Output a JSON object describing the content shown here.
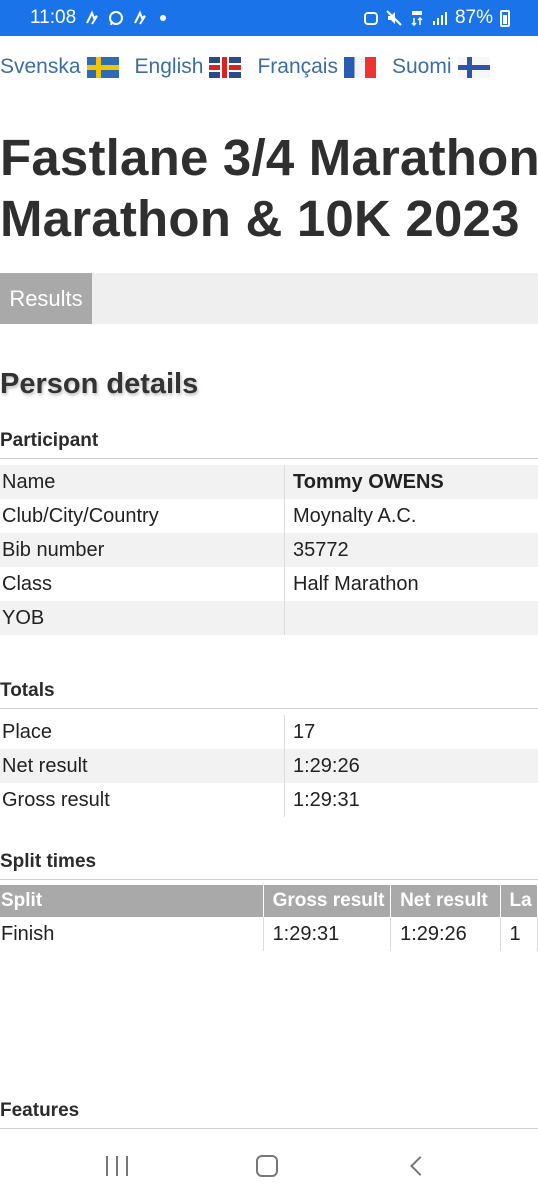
{
  "statusbar": {
    "time": "11:08",
    "battery": "87%"
  },
  "languages": [
    {
      "label": "Svenska",
      "flag": "sweden-flag"
    },
    {
      "label": "English",
      "flag": "uk-flag"
    },
    {
      "label": "Français",
      "flag": "france-flag"
    },
    {
      "label": "Suomi",
      "flag": "finland-flag"
    }
  ],
  "page": {
    "title_line1": "Fastlane 3/4 Marathon,",
    "title_line2": "Marathon & 10K 2023",
    "tab": "Results",
    "section_title": "Person details"
  },
  "participant": {
    "heading": "Participant",
    "rows": [
      {
        "label": "Name",
        "value": "Tommy OWENS"
      },
      {
        "label": "Club/City/Country",
        "value": "Moynalty A.C."
      },
      {
        "label": "Bib number",
        "value": "35772"
      },
      {
        "label": "Class",
        "value": "Half Marathon"
      },
      {
        "label": "YOB",
        "value": ""
      }
    ]
  },
  "totals": {
    "heading": "Totals",
    "rows": [
      {
        "label": "Place",
        "value": "17"
      },
      {
        "label": "Net result",
        "value": "1:29:26"
      },
      {
        "label": "Gross result",
        "value": "1:29:31"
      }
    ]
  },
  "splits": {
    "heading": "Split times",
    "columns": [
      "Split",
      "Gross result",
      "Net result",
      "La"
    ],
    "rows": [
      {
        "split": "Finish",
        "gross": "1:29:31",
        "net": "1:29:26",
        "extra": "1"
      }
    ]
  },
  "features": {
    "heading": "Features"
  }
}
